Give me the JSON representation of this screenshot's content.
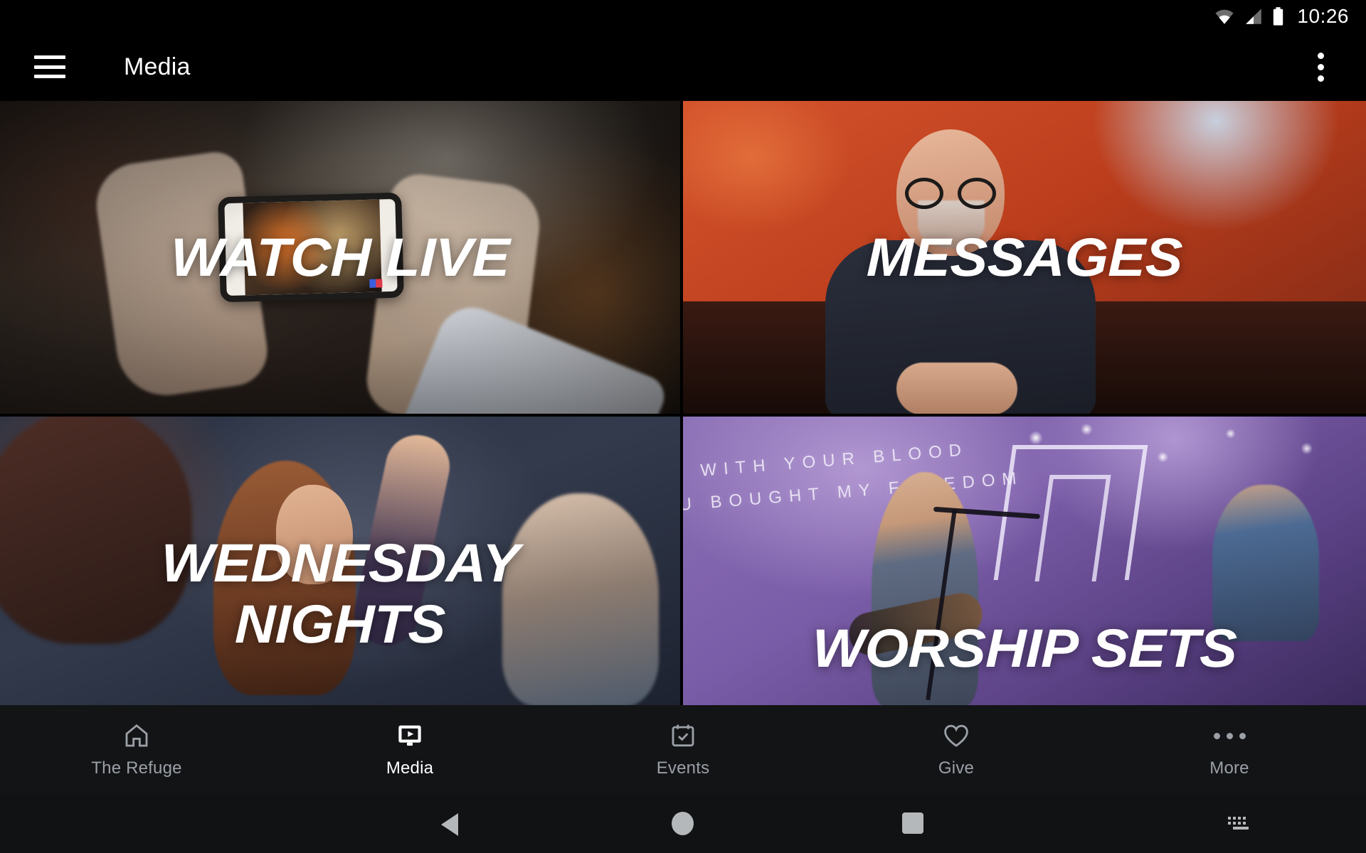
{
  "status_bar": {
    "time": "10:26",
    "icons": [
      "wifi-icon",
      "cellular-signal-icon",
      "battery-icon"
    ]
  },
  "app_bar": {
    "menu_icon": "hamburger-menu-icon",
    "title": "Media",
    "overflow_icon": "overflow-menu-icon"
  },
  "media_grid": {
    "tiles": [
      {
        "id": "watch-live",
        "label": "WATCH LIVE",
        "label_line2": ""
      },
      {
        "id": "messages",
        "label": "MESSAGES",
        "label_line2": ""
      },
      {
        "id": "wednesday-nights",
        "label": "WEDNESDAY",
        "label_line2": "NIGHTS"
      },
      {
        "id": "worship-sets",
        "label": "WORSHIP SETS",
        "label_line2": ""
      }
    ],
    "worship_background_lyrics": {
      "line1": "WITH YOUR BLOOD",
      "line2": "U BOUGHT MY FREEDOM"
    }
  },
  "tab_bar": {
    "items": [
      {
        "label": "The Refuge",
        "icon": "home-icon",
        "active": false
      },
      {
        "label": "Media",
        "icon": "media-monitor-play-icon",
        "active": true
      },
      {
        "label": "Events",
        "icon": "calendar-check-icon",
        "active": false
      },
      {
        "label": "Give",
        "icon": "heart-icon",
        "active": false
      },
      {
        "label": "More",
        "icon": "more-horizontal-dots-icon",
        "active": false
      }
    ],
    "active_color": "#ffffff",
    "inactive_color": "#9aa0a6",
    "background_color": "#131416"
  },
  "system_nav_bar": {
    "buttons": [
      "back-triangle-icon",
      "home-circle-icon",
      "recents-square-icon",
      "keyboard-switcher-icon"
    ],
    "background_color": "#111213",
    "icon_color": "#b5b8ba"
  }
}
